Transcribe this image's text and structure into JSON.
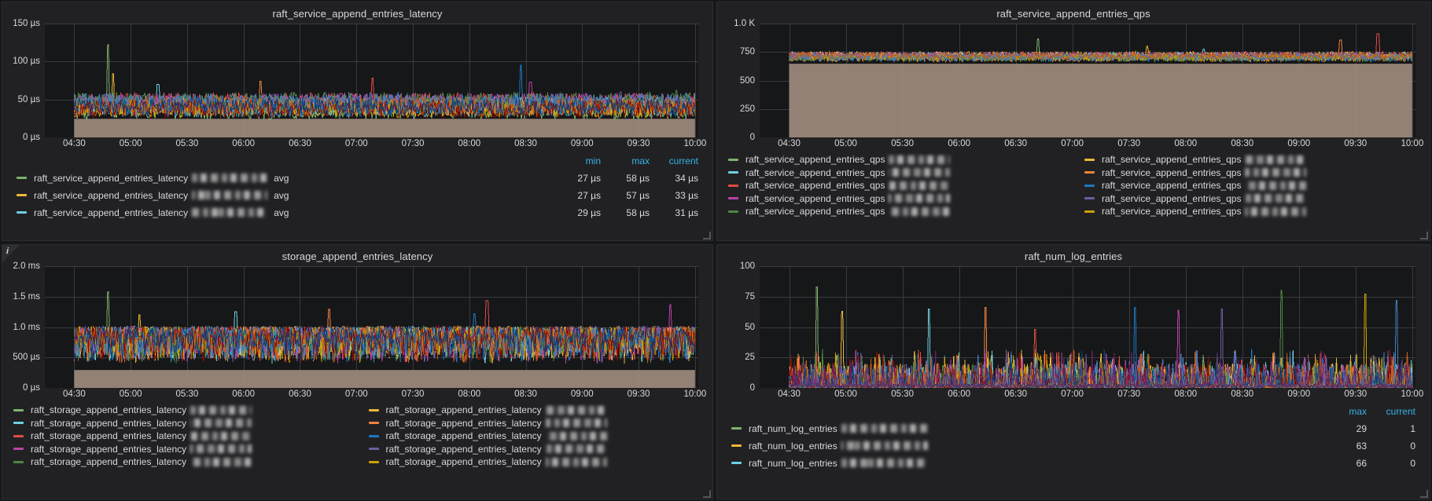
{
  "theme": {
    "page_bg": "#161719",
    "panel_bg": "#212124",
    "plot_bg": "#161719",
    "text": "#d8d9da",
    "accent": "#33b5e5",
    "grid": "#3a3a40",
    "fill": "#a08b7d"
  },
  "panels": [
    {
      "id": "raft-service-append-entries-latency",
      "title": "raft_service_append_entries_latency",
      "info_icon": "i",
      "has_info_icon": false,
      "y_ticks": [
        "150 µs",
        "100 µs",
        "50 µs",
        "0 µs"
      ],
      "x_ticks": [
        "04:30",
        "05:00",
        "05:30",
        "06:00",
        "06:30",
        "07:00",
        "07:30",
        "08:00",
        "08:30",
        "09:00",
        "09:30",
        "10:00"
      ],
      "legend_columns": [
        "min",
        "max",
        "current"
      ],
      "legend_layout": "table",
      "legend_rows": [
        {
          "color": "#7eb26d",
          "label": "raft_service_append_entries_latency",
          "redacted": true,
          "suffix": "avg",
          "values": [
            "27 µs",
            "58 µs",
            "34 µs"
          ]
        },
        {
          "color": "#eab839",
          "label": "raft_service_append_entries_latency",
          "redacted": true,
          "suffix": "avg",
          "values": [
            "27 µs",
            "57 µs",
            "33 µs"
          ]
        },
        {
          "color": "#6ed0e0",
          "label": "raft_service_append_entries_latency",
          "redacted": true,
          "suffix": "avg",
          "values": [
            "29 µs",
            "58 µs",
            "31 µs"
          ]
        }
      ]
    },
    {
      "id": "raft-service-append-entries-qps",
      "title": "raft_service_append_entries_qps",
      "has_info_icon": false,
      "y_ticks": [
        "1.0 K",
        "750",
        "500",
        "250",
        "0"
      ],
      "x_ticks": [
        "04:30",
        "05:00",
        "05:30",
        "06:00",
        "06:30",
        "07:00",
        "07:30",
        "08:00",
        "08:30",
        "09:00",
        "09:30",
        "10:00"
      ],
      "legend_columns": [],
      "legend_layout": "two-column",
      "legend_rows": [
        {
          "color": "#7eb26d",
          "label": "raft_service_append_entries_qps",
          "redacted": true,
          "suffix": "",
          "values": []
        },
        {
          "color": "#eab839",
          "label": "raft_service_append_entries_qps",
          "redacted": true,
          "suffix": "",
          "values": []
        },
        {
          "color": "#6ed0e0",
          "label": "raft_service_append_entries_qps",
          "redacted": true,
          "suffix": "",
          "values": []
        },
        {
          "color": "#ef843c",
          "label": "raft_service_append_entries_qps",
          "redacted": true,
          "suffix": "",
          "values": []
        },
        {
          "color": "#e24d42",
          "label": "raft_service_append_entries_qps",
          "redacted": true,
          "suffix": "",
          "values": []
        },
        {
          "color": "#1f78c1",
          "label": "raft_service_append_entries_qps",
          "redacted": true,
          "suffix": "",
          "values": []
        },
        {
          "color": "#ba43a9",
          "label": "raft_service_append_entries_qps",
          "redacted": true,
          "suffix": "",
          "values": []
        },
        {
          "color": "#705da0",
          "label": "raft_service_append_entries_qps",
          "redacted": true,
          "suffix": "",
          "values": []
        },
        {
          "color": "#508642",
          "label": "raft_service_append_entries_qps",
          "redacted": true,
          "suffix": "",
          "values": []
        },
        {
          "color": "#cca300",
          "label": "raft_service_append_entries_qps",
          "redacted": true,
          "suffix": "",
          "values": []
        }
      ]
    },
    {
      "id": "storage-append-entries-latency",
      "title": "storage_append_entries_latency",
      "has_info_icon": true,
      "info_icon": "i",
      "y_ticks": [
        "2.0 ms",
        "1.5 ms",
        "1.0 ms",
        "500 µs",
        "0 µs"
      ],
      "x_ticks": [
        "04:30",
        "05:00",
        "05:30",
        "06:00",
        "06:30",
        "07:00",
        "07:30",
        "08:00",
        "08:30",
        "09:00",
        "09:30",
        "10:00"
      ],
      "legend_columns": [],
      "legend_layout": "two-column",
      "legend_rows": [
        {
          "color": "#7eb26d",
          "label": "raft_storage_append_entries_latency",
          "redacted": true,
          "suffix": "",
          "values": []
        },
        {
          "color": "#eab839",
          "label": "raft_storage_append_entries_latency",
          "redacted": true,
          "suffix": "",
          "values": []
        },
        {
          "color": "#6ed0e0",
          "label": "raft_storage_append_entries_latency",
          "redacted": true,
          "suffix": "",
          "values": []
        },
        {
          "color": "#ef843c",
          "label": "raft_storage_append_entries_latency",
          "redacted": true,
          "suffix": "",
          "values": []
        },
        {
          "color": "#e24d42",
          "label": "raft_storage_append_entries_latency",
          "redacted": true,
          "suffix": "",
          "values": []
        },
        {
          "color": "#1f78c1",
          "label": "raft_storage_append_entries_latency",
          "redacted": true,
          "suffix": "",
          "values": []
        },
        {
          "color": "#ba43a9",
          "label": "raft_storage_append_entries_latency",
          "redacted": true,
          "suffix": "",
          "values": []
        },
        {
          "color": "#705da0",
          "label": "raft_storage_append_entries_latency",
          "redacted": true,
          "suffix": "",
          "values": []
        },
        {
          "color": "#508642",
          "label": "raft_storage_append_entries_latency",
          "redacted": true,
          "suffix": "",
          "values": []
        },
        {
          "color": "#cca300",
          "label": "raft_storage_append_entries_latency",
          "redacted": true,
          "suffix": "",
          "values": []
        }
      ]
    },
    {
      "id": "raft-num-log-entries",
      "title": "raft_num_log_entries",
      "has_info_icon": false,
      "y_ticks": [
        "100",
        "75",
        "50",
        "25",
        "0"
      ],
      "x_ticks": [
        "04:30",
        "05:00",
        "05:30",
        "06:00",
        "06:30",
        "07:00",
        "07:30",
        "08:00",
        "08:30",
        "09:00",
        "09:30",
        "10:00"
      ],
      "legend_columns": [
        "max",
        "current"
      ],
      "legend_layout": "table",
      "legend_rows": [
        {
          "color": "#7eb26d",
          "label": "raft_num_log_entries",
          "redacted": true,
          "suffix": "",
          "values": [
            "29",
            "1"
          ]
        },
        {
          "color": "#eab839",
          "label": "raft_num_log_entries",
          "redacted": true,
          "suffix": "",
          "values": [
            "63",
            "0"
          ]
        },
        {
          "color": "#6ed0e0",
          "label": "raft_num_log_entries",
          "redacted": true,
          "suffix": "",
          "values": [
            "66",
            "0"
          ]
        }
      ]
    }
  ],
  "chart_data": [
    {
      "type": "line",
      "title": "raft_service_append_entries_latency",
      "xlabel": "",
      "ylabel": "",
      "unit": "µs",
      "ylim": [
        0,
        150
      ],
      "y_ticks": [
        0,
        50,
        100,
        150
      ],
      "x_ticks": [
        "04:30",
        "05:00",
        "05:30",
        "06:00",
        "06:30",
        "07:00",
        "07:30",
        "08:00",
        "08:30",
        "09:00",
        "09:30",
        "10:00"
      ],
      "grid": true,
      "legend_position": "bottom",
      "noise_band": [
        25,
        55
      ],
      "baseline_fill_to": 0,
      "peaks": [
        {
          "x_frac": 0.055,
          "value": 122
        },
        {
          "x_frac": 0.062,
          "value": 84
        },
        {
          "x_frac": 0.135,
          "value": 70
        },
        {
          "x_frac": 0.3,
          "value": 74
        },
        {
          "x_frac": 0.48,
          "value": 78
        },
        {
          "x_frac": 0.72,
          "value": 95
        },
        {
          "x_frac": 0.735,
          "value": 73
        },
        {
          "x_frac": 0.88,
          "value": 60
        },
        {
          "x_frac": 0.97,
          "value": 62
        }
      ],
      "series_stats": [
        {
          "name": "series-1",
          "min": 27,
          "max": 58,
          "current": 34
        },
        {
          "name": "series-2",
          "min": 27,
          "max": 57,
          "current": 33
        },
        {
          "name": "series-3",
          "min": 29,
          "max": 58,
          "current": 31
        }
      ]
    },
    {
      "type": "line",
      "title": "raft_service_append_entries_qps",
      "xlabel": "",
      "ylabel": "",
      "unit": "",
      "ylim": [
        0,
        1000
      ],
      "y_ticks": [
        0,
        250,
        500,
        750,
        1000
      ],
      "y_tick_labels": [
        "0",
        "250",
        "500",
        "750",
        "1.0 K"
      ],
      "x_ticks": [
        "04:30",
        "05:00",
        "05:30",
        "06:00",
        "06:30",
        "07:00",
        "07:30",
        "08:00",
        "08:30",
        "09:00",
        "09:30",
        "10:00"
      ],
      "grid": true,
      "legend_position": "bottom",
      "noise_band": [
        660,
        740
      ],
      "baseline_fill_to": 0,
      "peaks": [
        {
          "x_frac": 0.4,
          "value": 865
        },
        {
          "x_frac": 0.575,
          "value": 800
        },
        {
          "x_frac": 0.665,
          "value": 775
        },
        {
          "x_frac": 0.885,
          "value": 855
        },
        {
          "x_frac": 0.945,
          "value": 910
        }
      ]
    },
    {
      "type": "line",
      "title": "storage_append_entries_latency",
      "xlabel": "",
      "ylabel": "",
      "unit": "ms",
      "ylim": [
        0,
        2.0
      ],
      "y_ticks": [
        0,
        0.5,
        1.0,
        1.5,
        2.0
      ],
      "y_tick_labels": [
        "0 µs",
        "500 µs",
        "1.0 ms",
        "1.5 ms",
        "2.0 ms"
      ],
      "x_ticks": [
        "04:30",
        "05:00",
        "05:30",
        "06:00",
        "06:30",
        "07:00",
        "07:30",
        "08:00",
        "08:30",
        "09:00",
        "09:30",
        "10:00"
      ],
      "grid": true,
      "legend_position": "bottom",
      "noise_band": [
        0.3,
        0.95
      ],
      "baseline_fill_to": 0,
      "peaks": [
        {
          "x_frac": 0.055,
          "value": 1.58
        },
        {
          "x_frac": 0.105,
          "value": 1.2
        },
        {
          "x_frac": 0.26,
          "value": 1.25
        },
        {
          "x_frac": 0.41,
          "value": 1.3
        },
        {
          "x_frac": 0.665,
          "value": 1.43
        },
        {
          "x_frac": 0.645,
          "value": 1.22
        },
        {
          "x_frac": 0.96,
          "value": 1.37
        }
      ]
    },
    {
      "type": "line",
      "title": "raft_num_log_entries",
      "xlabel": "",
      "ylabel": "",
      "unit": "",
      "ylim": [
        0,
        100
      ],
      "y_ticks": [
        0,
        25,
        50,
        75,
        100
      ],
      "x_ticks": [
        "04:30",
        "05:00",
        "05:30",
        "06:00",
        "06:30",
        "07:00",
        "07:30",
        "08:00",
        "08:30",
        "09:00",
        "09:30",
        "10:00"
      ],
      "grid": true,
      "legend_position": "bottom",
      "noise_band": [
        0,
        12
      ],
      "baseline_fill_to": 0,
      "peaks": [
        {
          "x_frac": 0.045,
          "value": 83
        },
        {
          "x_frac": 0.085,
          "value": 63
        },
        {
          "x_frac": 0.225,
          "value": 65
        },
        {
          "x_frac": 0.315,
          "value": 66
        },
        {
          "x_frac": 0.395,
          "value": 48
        },
        {
          "x_frac": 0.555,
          "value": 66
        },
        {
          "x_frac": 0.625,
          "value": 64
        },
        {
          "x_frac": 0.695,
          "value": 65
        },
        {
          "x_frac": 0.79,
          "value": 80
        },
        {
          "x_frac": 0.925,
          "value": 77
        },
        {
          "x_frac": 0.975,
          "value": 72
        }
      ],
      "series_stats": [
        {
          "name": "series-1",
          "max": 29,
          "current": 1
        },
        {
          "name": "series-2",
          "max": 63,
          "current": 0
        },
        {
          "name": "series-3",
          "max": 66,
          "current": 0
        }
      ]
    }
  ]
}
